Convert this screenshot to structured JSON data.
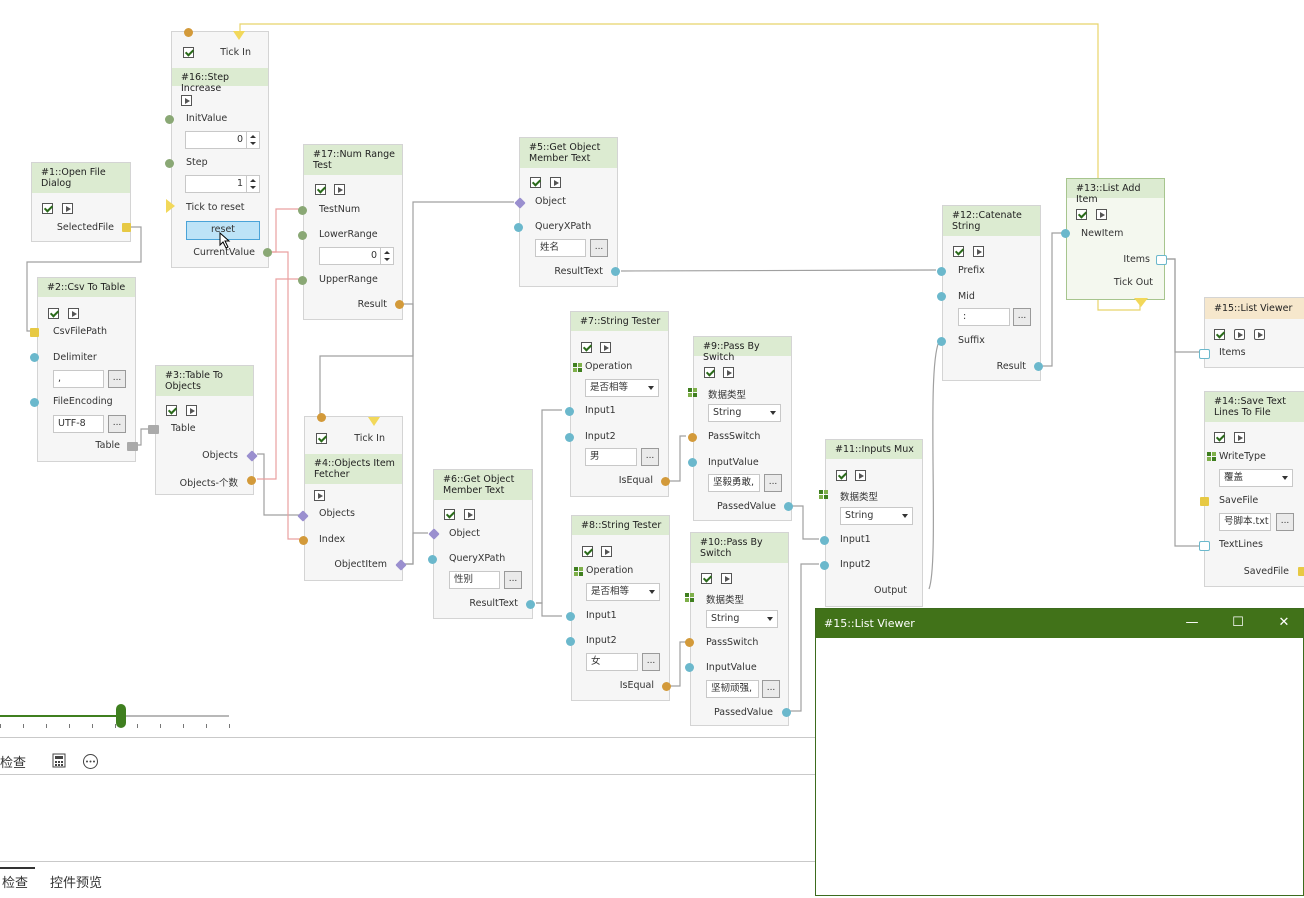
{
  "colors": {
    "header_green": "#dcebd1",
    "header_orange": "#f6e7cc",
    "window_title": "#417219",
    "wire_gray": "#a0a0a0",
    "wire_yellow": "#e8d46a",
    "wire_red": "#e9a0a0",
    "button_blue": "#bde3f7"
  },
  "nodes": {
    "n1": {
      "title": "#1::Open File Dialog",
      "out": "SelectedFile"
    },
    "n2": {
      "title": "#2::Csv To Table",
      "in1": "CsvFilePath",
      "in2": "Delimiter",
      "delim_val": ",",
      "in3": "FileEncoding",
      "enc_val": "UTF-8",
      "out": "Table"
    },
    "n3": {
      "title": "#3::Table To Objects",
      "in": "Table",
      "out1": "Objects",
      "out2": "Objects-个数"
    },
    "n16": {
      "title": "#16::Step Increase",
      "tick": "Tick In",
      "in1": "InitValue",
      "init_val": "0",
      "in2": "Step",
      "step_val": "1",
      "in3": "Tick to reset",
      "btn": "reset",
      "out": "CurrentValue"
    },
    "n17": {
      "title": "#17::Num Range Test",
      "in1": "TestNum",
      "in2": "LowerRange",
      "lower_val": "0",
      "in3": "UpperRange",
      "out": "Result"
    },
    "n4": {
      "title": "#4::Objects Item Fetcher",
      "tick": "Tick In",
      "in1": "Objects",
      "in2": "Index",
      "out": "ObjectItem"
    },
    "n5": {
      "title": "#5::Get Object Member Text",
      "in1": "Object",
      "in2": "QueryXPath",
      "xpath_val": "姓名",
      "out": "ResultText"
    },
    "n6": {
      "title": "#6::Get Object Member Text",
      "in1": "Object",
      "in2": "QueryXPath",
      "xpath_val": "性别",
      "out": "ResultText"
    },
    "n7": {
      "title": "#7::String Tester",
      "in0": "Operation",
      "op_val": "是否相等",
      "in1": "Input1",
      "in2": "Input2",
      "in2_val": "男",
      "out": "IsEqual"
    },
    "n8": {
      "title": "#8::String Tester",
      "in0": "Operation",
      "op_val": "是否相等",
      "in1": "Input1",
      "in2": "Input2",
      "in2_val": "女",
      "out": "IsEqual"
    },
    "n9": {
      "title": "#9::Pass By Switch",
      "in0": "数据类型",
      "type_val": "String",
      "in1": "PassSwitch",
      "in2": "InputValue",
      "in2_val": "坚毅勇敢,",
      "out": "PassedValue"
    },
    "n10": {
      "title": "#10::Pass By Switch",
      "in0": "数据类型",
      "type_val": "String",
      "in1": "PassSwitch",
      "in2": "InputValue",
      "in2_val": "坚韧顽强,",
      "out": "PassedValue"
    },
    "n11": {
      "title": "#11::Inputs Mux",
      "in0": "数据类型",
      "type_val": "String",
      "in1": "Input1",
      "in2": "Input2",
      "out": "Output"
    },
    "n12": {
      "title": "#12::Catenate String",
      "in1": "Prefix",
      "in2": "Mid",
      "mid_val": ":",
      "in3": "Suffix",
      "out": "Result"
    },
    "n13": {
      "title": "#13::List Add Item",
      "in1": "NewItem",
      "out1": "Items",
      "out2": "Tick Out"
    },
    "n15": {
      "title": "#15::List Viewer",
      "in": "Items"
    },
    "n14": {
      "title": "#14::Save Text Lines To File",
      "in0": "WriteType",
      "wt_val": "覆盖",
      "in1": "SaveFile",
      "file_val": "号脚本.txt",
      "in2": "TextLines",
      "out": "SavedFile"
    }
  },
  "dots_label": "...",
  "panel": {
    "inspect_label": "检查",
    "tab1": "检查",
    "tab2": "控件预览"
  },
  "slider": {
    "value": 0.53
  },
  "window": {
    "title": "#15::List Viewer",
    "min": "—",
    "max": "☐",
    "close": "✕"
  }
}
